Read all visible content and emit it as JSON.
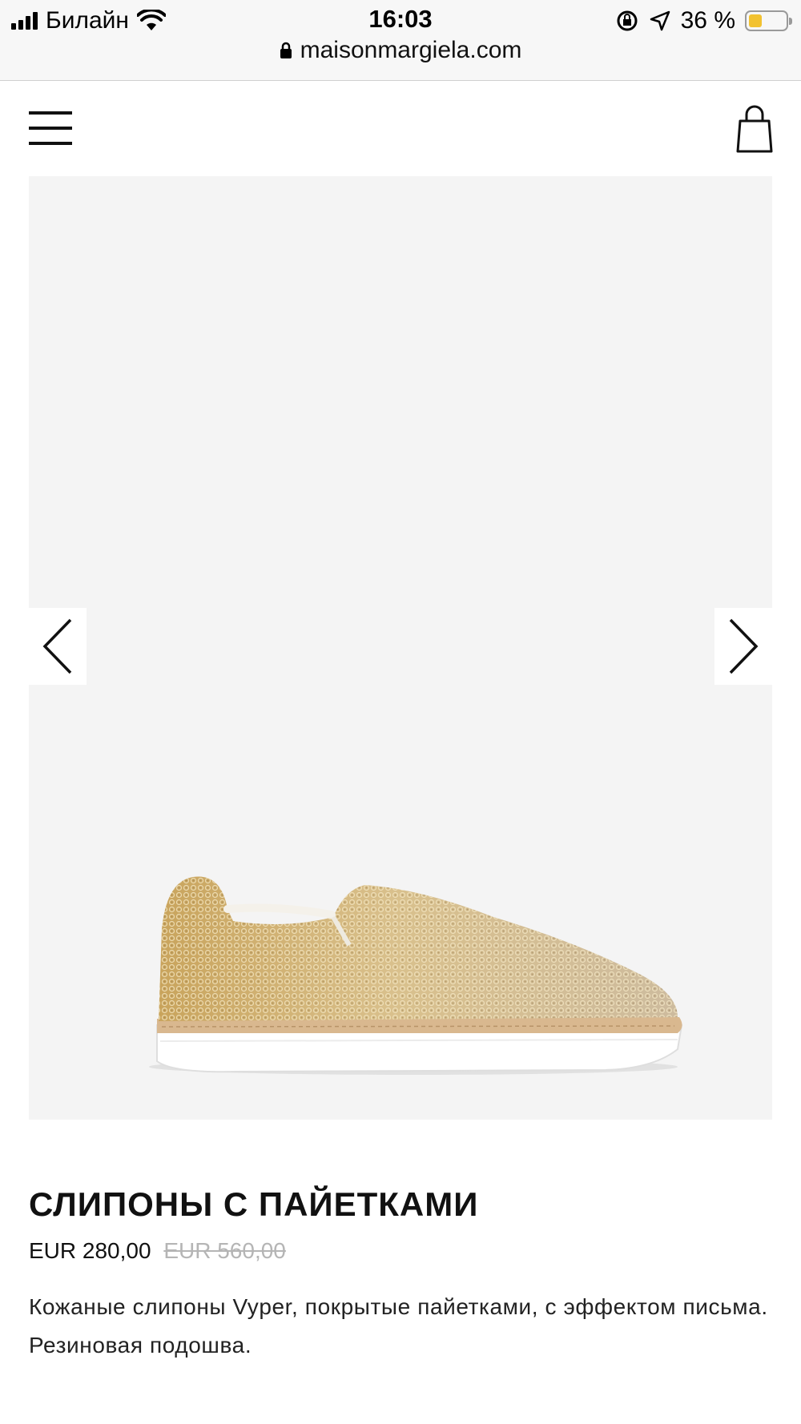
{
  "status_bar": {
    "carrier": "Билайн",
    "time": "16:03",
    "battery_percent": "36 %",
    "battery_level": 0.36
  },
  "browser": {
    "url": "maisonmargiela.com"
  },
  "header": {
    "menu_icon": "hamburger-menu-icon",
    "cart_icon": "shopping-bag-icon"
  },
  "gallery": {
    "prev_icon": "chevron-left-icon",
    "next_icon": "chevron-right-icon",
    "image": "gold-sequin-slip-on-sneaker"
  },
  "product": {
    "title": "СЛИПОНЫ С ПАЙЕТКАМИ",
    "price": "EUR 280,00",
    "old_price": "EUR 560,00",
    "description": "Кожаные слипоны Vyper, покрытые пайетками, с эффектом письма. Резиновая подошва."
  },
  "colors": {
    "accent_text": "#111111",
    "old_price": "#b5b5b5",
    "gallery_bg": "#f4f4f4",
    "battery_fill": "#f2c230"
  }
}
